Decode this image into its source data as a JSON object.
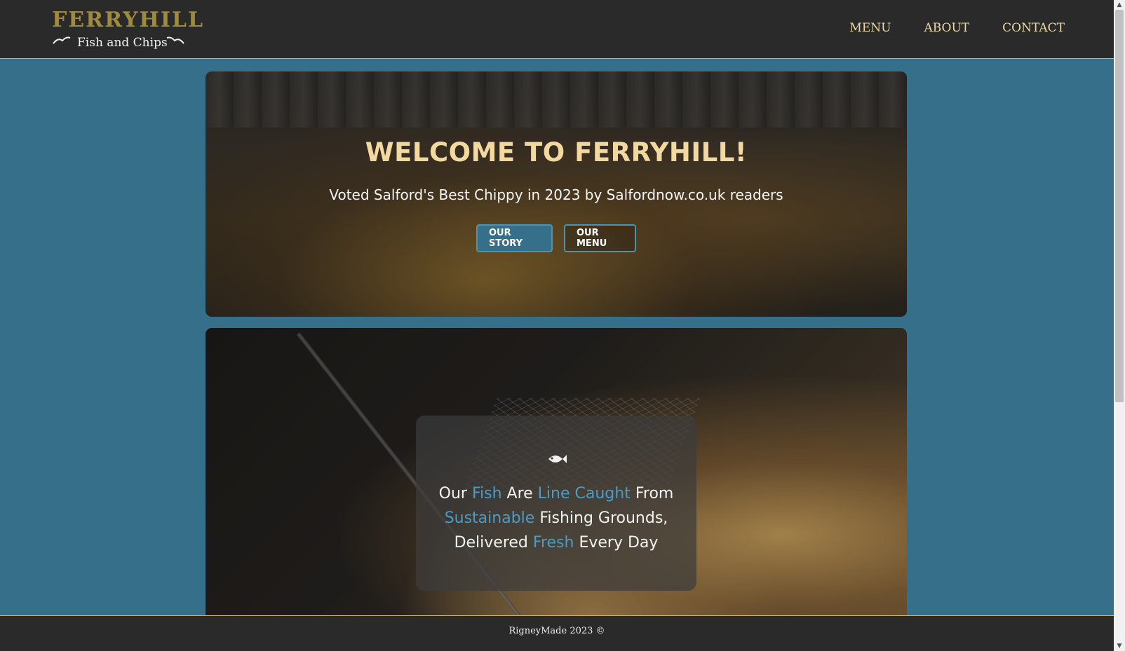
{
  "header": {
    "logo_title": "FERRYHILL",
    "logo_subtitle": "Fish and Chips",
    "nav": [
      "MENU",
      "ABOUT",
      "CONTACT"
    ]
  },
  "hero": {
    "title": "WELCOME TO FERRYHILL!",
    "subtitle": "Voted Salford's Best Chippy in 2023 by Salfordnow.co.uk readers",
    "buttons": {
      "story": "OUR STORY",
      "menu": "OUR MENU"
    }
  },
  "feature": {
    "icon": "fish-icon",
    "text_parts": [
      "Our ",
      "Fish",
      " Are ",
      "Line Caught",
      " From ",
      "Sustainable",
      " Fishing Grounds, Delivered ",
      "Fresh",
      " Every Day"
    ]
  },
  "footer": {
    "text": "RigneyMade 2023 ©"
  },
  "colors": {
    "header_bg": "#2a2a2a",
    "page_bg": "#356f8a",
    "logo_gold": "#a08a3d",
    "nav_text": "#ecd9a6",
    "hero_title": "#f3d9a0",
    "highlight": "#4a9cc6",
    "button_border": "#4a93b2"
  }
}
